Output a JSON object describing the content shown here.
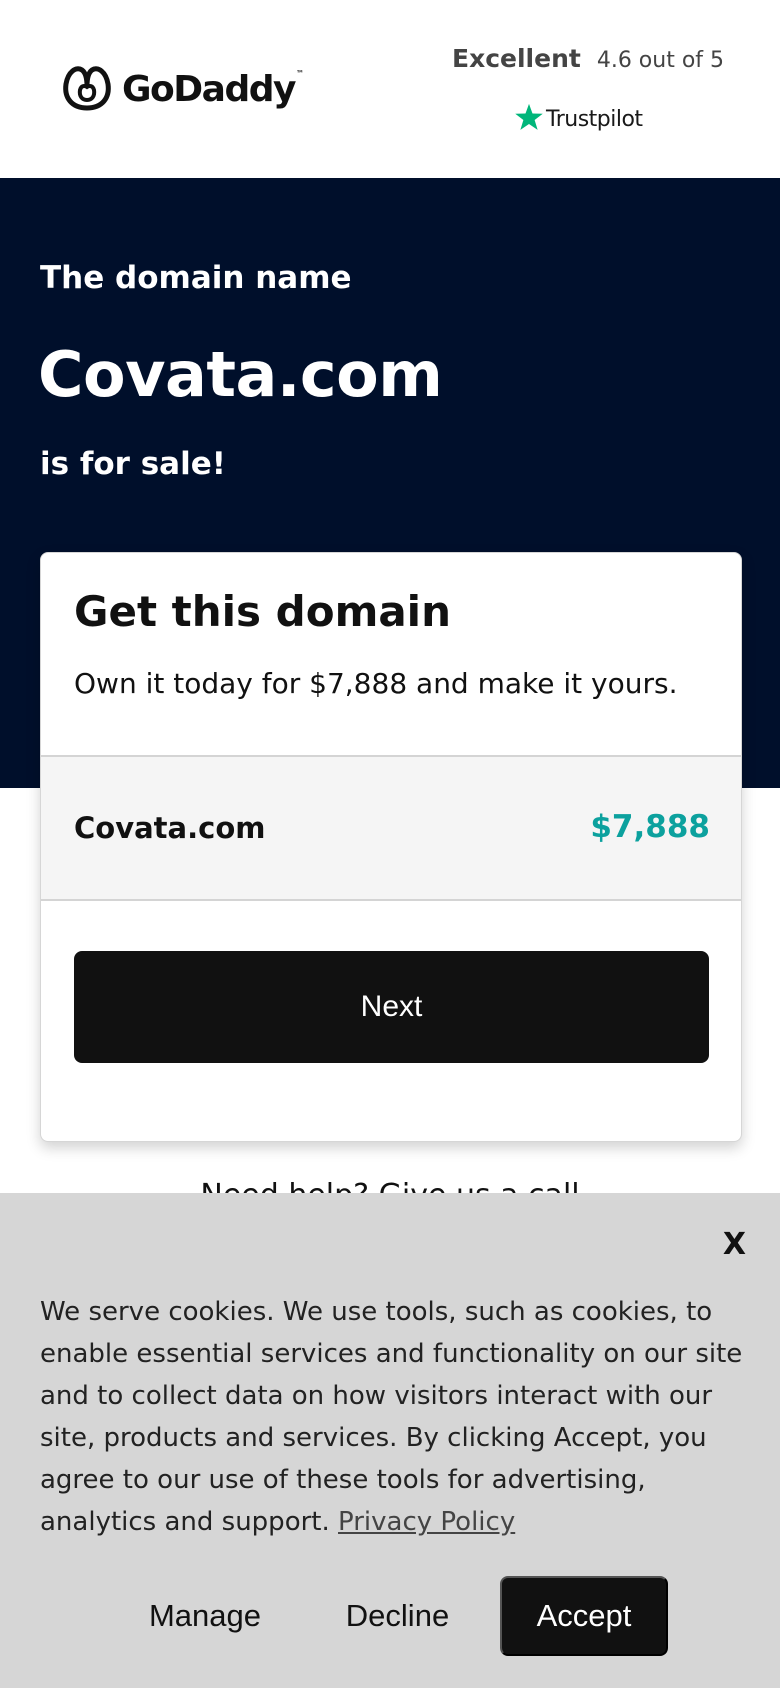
{
  "header": {
    "logo_text": "GoDaddy",
    "logo_tm": "™",
    "rating_word": "Excellent",
    "rating_score": "4.6 out of 5",
    "trustpilot_label": "Trustpilot",
    "trustpilot_color": "#00b67a"
  },
  "hero": {
    "pre": "The domain name",
    "domain": "Covata.com",
    "post": "is for sale!",
    "background": "#000f2b"
  },
  "card": {
    "title": "Get this domain",
    "subtitle": "Own it today for $7,888 and make it yours.",
    "domain": "Covata.com",
    "price": "$7,888",
    "price_color": "#0ca19e",
    "next_label": "Next"
  },
  "help_peek": "Need help? Give us a call",
  "cookie": {
    "close_label": "X",
    "text": "We serve cookies. We use tools, such as cookies, to enable essential services and functionality on our site and to collect data on how visitors interact with our site, products and services. By clicking Accept, you agree to our use of these tools for advertising, analytics and support.",
    "privacy_link": "Privacy Policy",
    "manage_label": "Manage",
    "decline_label": "Decline",
    "accept_label": "Accept"
  }
}
